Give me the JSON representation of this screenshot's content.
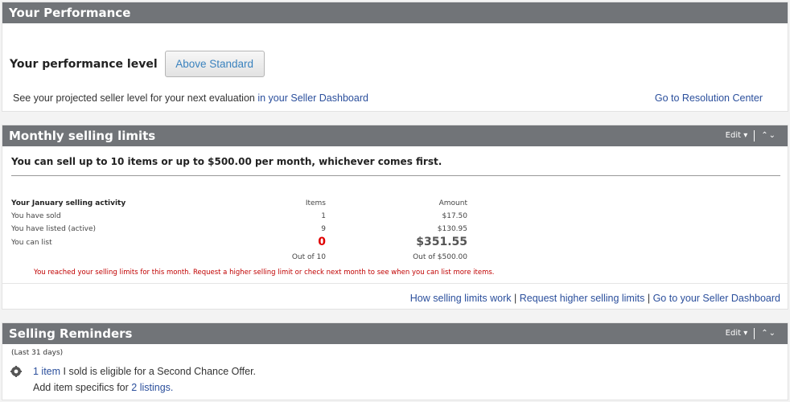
{
  "performance": {
    "title": "Your Performance",
    "level_label": "Your performance level",
    "level_value": "Above Standard",
    "projection_text": "See your projected seller level for your next evaluation",
    "projection_link": "in your Seller Dashboard",
    "resolution_link": "Go to Resolution Center"
  },
  "limits": {
    "title": "Monthly selling limits",
    "edit_label": "Edit ▾",
    "arrows": "⌃⌄",
    "summary": "You can sell up to 10 items or up to $500.00 per month, whichever comes first.",
    "activity_title": "Your January selling activity",
    "col_items": "Items",
    "col_amount": "Amount",
    "rows": [
      {
        "label": "You have sold",
        "items": "1",
        "amount": "$17.50"
      },
      {
        "label": "You have listed (active)",
        "items": "9",
        "amount": "$130.95"
      },
      {
        "label": "You can list",
        "items": "0",
        "amount": "$351.55"
      }
    ],
    "out_of_items": "Out of 10",
    "out_of_amount": "Out of $500.00",
    "warning": "You reached your selling limits for this month. Request a higher selling limit or check next month to see when you can list more items.",
    "links": {
      "how": "How selling limits work",
      "request": "Request higher selling limits",
      "dashboard": "Go to your Seller Dashboard",
      "sep": "|"
    }
  },
  "reminders": {
    "title": "Selling Reminders",
    "edit_label": "Edit ▾",
    "period": "(Last 31 days)",
    "item1_link": "1 item",
    "item1_text": "I sold is eligible for a Second Chance Offer.",
    "item2_text": "Add item specifics for",
    "item2_link": "2 listings."
  }
}
